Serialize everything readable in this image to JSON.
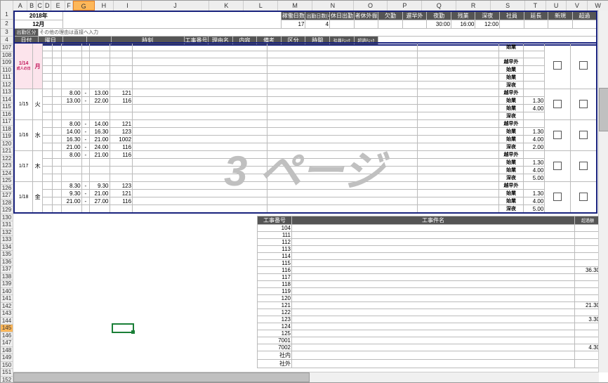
{
  "columns": [
    "A",
    "B",
    "C",
    "D",
    "E",
    "F",
    "G",
    "H",
    "I",
    "J",
    "K",
    "L",
    "M",
    "N",
    "O",
    "P",
    "Q",
    "R",
    "S",
    "T",
    "U",
    "V",
    "W"
  ],
  "selected_col": "G",
  "row_start": 1,
  "rows_top": [
    1,
    2,
    3,
    4
  ],
  "rows_mid": [
    107,
    108,
    109,
    110,
    111,
    112,
    113,
    114,
    115,
    116,
    117,
    118,
    119,
    120,
    121,
    122,
    123,
    124,
    125,
    126,
    127,
    128,
    129,
    130,
    131,
    132,
    133,
    134,
    135,
    136,
    137,
    138,
    139,
    140,
    141,
    142,
    143,
    144,
    145,
    146,
    147,
    148,
    149,
    150,
    151,
    152
  ],
  "selected_row": 145,
  "watermark": "3 ページ",
  "header": {
    "year": "2018年",
    "month": "12月",
    "note": "その他の理由は直接へ入力",
    "labels": {
      "kadou": "稼働日数",
      "shukkin_note": "出勤日数(=実出)",
      "kyujitsu": "休日出勤",
      "kyugai": "者休外振",
      "kekkin": "欠勤",
      "chisou": "遅早外",
      "yakin": "夜勤",
      "zangyo": "残業",
      "shinya": "深夜",
      "c1": "社員",
      "c2": "延長",
      "c3": "新規",
      "c4": "超過"
    },
    "values": {
      "kadou": "17",
      "shukkin": "4",
      "kyujitsu": "",
      "kyugai": "",
      "kekkin": "",
      "chisou": "",
      "yakin": "30:00",
      "zangyo": "16:00",
      "shinya": "12:00"
    }
  },
  "time_headers": {
    "a": "日付",
    "b": "曜日",
    "c": "出勤区分",
    "d": "時刻",
    "e": "工事番号",
    "f": "理由名",
    "g": "内容",
    "h": "備考",
    "i": "区分",
    "j": "時間",
    "k": "社員ﾁｪｯｸ",
    "l": "超過ﾁｪｯｸ"
  },
  "days": [
    {
      "date": "1/14",
      "dow": "月",
      "pink": true,
      "note": "成人の日",
      "rows": [
        {
          "kubun": [
            "始業",
            "",
            "越早外",
            "始業",
            "始業",
            "深夜"
          ]
        }
      ]
    },
    {
      "date": "1/15",
      "dow": "火",
      "rows": [
        {
          "t1": "8.00",
          "sep": "-",
          "t2": "13.00",
          "code": "121",
          "kubun": "越早外"
        },
        {
          "t1": "13.00",
          "sep": "-",
          "t2": "22.00",
          "code": "116",
          "kubun": "始業",
          "h": "1.30"
        },
        {
          "kubun": "始業",
          "h": "4.00"
        },
        {
          "kubun": "深夜"
        }
      ]
    },
    {
      "date": "1/16",
      "dow": "水",
      "rows": [
        {
          "t1": "8.00",
          "sep": "-",
          "t2": "14.00",
          "code": "121",
          "kubun": "越早外"
        },
        {
          "t1": "14.00",
          "sep": "-",
          "t2": "16.30",
          "code": "123",
          "kubun": "始業",
          "h": "1.30"
        },
        {
          "t1": "16.30",
          "sep": "-",
          "t2": "21.00",
          "code": "1002",
          "kubun": "始業",
          "h": "4.00"
        },
        {
          "t1": "21.00",
          "sep": "-",
          "t2": "24.00",
          "code": "116",
          "kubun": "深夜",
          "h": "2.00"
        }
      ]
    },
    {
      "date": "1/17",
      "dow": "木",
      "rows": [
        {
          "t1": "8.00",
          "sep": "-",
          "t2": "21.00",
          "code": "116",
          "kubun": "越早外"
        },
        {
          "kubun": "始業",
          "h": "1.30"
        },
        {
          "kubun": "始業",
          "h": "4.00"
        },
        {
          "kubun": "深夜",
          "h": "5.00"
        }
      ]
    },
    {
      "date": "1/18",
      "dow": "金",
      "rows": [
        {
          "t1": "8.30",
          "sep": "-",
          "t2": "9.30",
          "code": "123",
          "kubun": "越早外"
        },
        {
          "t1": "9.30",
          "sep": "-",
          "t2": "21.00",
          "code": "121",
          "kubun": "始業",
          "h": "1.30"
        },
        {
          "t1": "21.00",
          "sep": "-",
          "t2": "27.00",
          "code": "116",
          "kubun": "始業",
          "h": "4.00"
        },
        {
          "kubun": "深夜",
          "h": "5.00"
        }
      ]
    }
  ],
  "lower_headers": {
    "a": "工事番号",
    "b": "工事件名",
    "c": "超過額"
  },
  "lower_rows": [
    {
      "code": "104"
    },
    {
      "code": "111"
    },
    {
      "code": "112"
    },
    {
      "code": "113"
    },
    {
      "code": "114"
    },
    {
      "code": "115"
    },
    {
      "code": "116",
      "val": "36.30"
    },
    {
      "code": "117"
    },
    {
      "code": "118"
    },
    {
      "code": "119"
    },
    {
      "code": "120"
    },
    {
      "code": "121",
      "val": "21.30"
    },
    {
      "code": "122"
    },
    {
      "code": "123",
      "val": "3.30"
    },
    {
      "code": "124"
    },
    {
      "code": "125"
    },
    {
      "code": "7001"
    },
    {
      "code": "7002",
      "val": "4.30"
    },
    {
      "code": "社内"
    },
    {
      "code": "社外"
    }
  ]
}
